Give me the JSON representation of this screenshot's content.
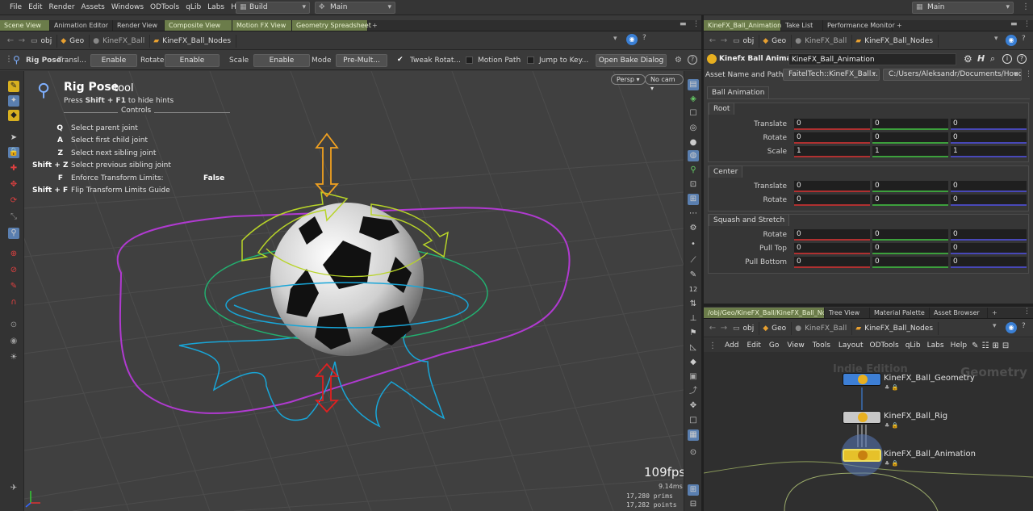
{
  "menubar": {
    "items": [
      "File",
      "Edit",
      "Render",
      "Assets",
      "Windows",
      "ODTools",
      "qLib",
      "Labs",
      "Help"
    ],
    "desktop_left": "Build",
    "desktop_mid": "Main",
    "desktop_right": "Main"
  },
  "left_tabs": [
    "Scene View",
    "Animation Editor",
    "Render View",
    "Composite View",
    "Motion FX View",
    "Geometry Spreadsheet"
  ],
  "left_path": {
    "obj": "obj",
    "geo": "Geo",
    "ball": "KineFX_Ball",
    "nodes": "KineFX_Ball_Nodes"
  },
  "tool_options": {
    "title": "Rig Pose",
    "translate_label": "Transl...",
    "translate_value": "Enable",
    "rotate_label": "Rotate",
    "rotate_value": "Enable",
    "scale_label": "Scale",
    "scale_value": "Enable",
    "mode_label": "Mode",
    "mode_value": "Pre-Mult...",
    "tweak_label": "Tweak Rotat...",
    "motion_path_label": "Motion Path",
    "jump_label": "Jump to Key...",
    "bake_button": "Open Bake Dialog"
  },
  "hud": {
    "title": "Rig Pose",
    "title_suffix": "tool",
    "hint_pre": "Press ",
    "hint_key": "Shift + F1",
    "hint_post": " to hide hints",
    "controls_label": "Controls",
    "rows": [
      {
        "key": "Q",
        "desc": "Select parent joint"
      },
      {
        "key": "A",
        "desc": "Select first child joint"
      },
      {
        "key": "Z",
        "desc": "Select next sibling joint"
      },
      {
        "key": "Shift + Z",
        "desc": "Select previous sibling joint"
      },
      {
        "key": "F",
        "desc": "Enforce Transform Limits:",
        "value": "False"
      },
      {
        "key": "Shift + F",
        "desc": "Flip Transform Limits Guide"
      }
    ]
  },
  "viewport": {
    "persp": "Persp",
    "cam": "No cam",
    "fps": "109fps",
    "ms": "9.14ms",
    "prims": "17,280  prims",
    "points": "17,282 points"
  },
  "right_tabs": [
    "KineFX_Ball_Animation",
    "Take List",
    "Performance Monitor"
  ],
  "right_path": {
    "obj": "obj",
    "geo": "Geo",
    "ball": "KineFX_Ball",
    "nodes": "KineFX_Ball_Nodes"
  },
  "params": {
    "node_type": "Kinefx Ball Animation",
    "node_name": "KineFX_Ball_Animation",
    "asset_label": "Asset Name and Path",
    "asset_name": "FaitelTech::KineFX_Ball...",
    "asset_path": "C:/Users/Aleksandr/Documents/Houdini...",
    "tab": "Ball Animation",
    "sections": [
      {
        "name": "Root",
        "rows": [
          {
            "label": "Translate",
            "values": [
              "0",
              "0",
              "0"
            ]
          },
          {
            "label": "Rotate",
            "values": [
              "0",
              "0",
              "0"
            ]
          },
          {
            "label": "Scale",
            "values": [
              "1",
              "1",
              "1"
            ]
          }
        ]
      },
      {
        "name": "Center",
        "rows": [
          {
            "label": "Translate",
            "values": [
              "0",
              "0",
              "0"
            ]
          },
          {
            "label": "Rotate",
            "values": [
              "0",
              "0",
              "0"
            ]
          }
        ]
      },
      {
        "name": "Squash and Stretch",
        "rows": [
          {
            "label": "Rotate",
            "values": [
              "0",
              "0",
              "0"
            ]
          },
          {
            "label": "Pull Top",
            "values": [
              "0",
              "0",
              "0"
            ]
          },
          {
            "label": "Pull Bottom",
            "values": [
              "0",
              "0",
              "0"
            ]
          }
        ]
      }
    ]
  },
  "net_tabs": [
    "/obj/Geo/KineFX_Ball/KineFX_Ball_Nodes",
    "Tree View",
    "Material Palette",
    "Asset Browser"
  ],
  "net_path": {
    "obj": "obj",
    "geo": "Geo",
    "ball": "KineFX_Ball",
    "nodes": "KineFX_Ball_Nodes"
  },
  "net_menu": [
    "Add",
    "Edit",
    "Go",
    "View",
    "Tools",
    "Layout",
    "ODTools",
    "qLib",
    "Labs",
    "Help"
  ],
  "network": {
    "watermark_edition": "Indie Edition",
    "watermark_context": "Geometry",
    "nodes": [
      {
        "name": "KineFX_Ball_Geometry",
        "color": "#3d7fd6"
      },
      {
        "name": "KineFX_Ball_Rig",
        "color": "#c8c8c8"
      },
      {
        "name": "KineFX_Ball_Animation",
        "color": "#e6c12a"
      }
    ]
  },
  "colors": {
    "active_tab": "#6b7c4a",
    "magenta_ring": "#b03ad0",
    "cyan_curve": "#18a6d8",
    "green_ring": "#22b070",
    "yellow_gizmo": "#b8d428",
    "orange_arrow": "#f0a020",
    "red_arrow": "#e02020"
  }
}
